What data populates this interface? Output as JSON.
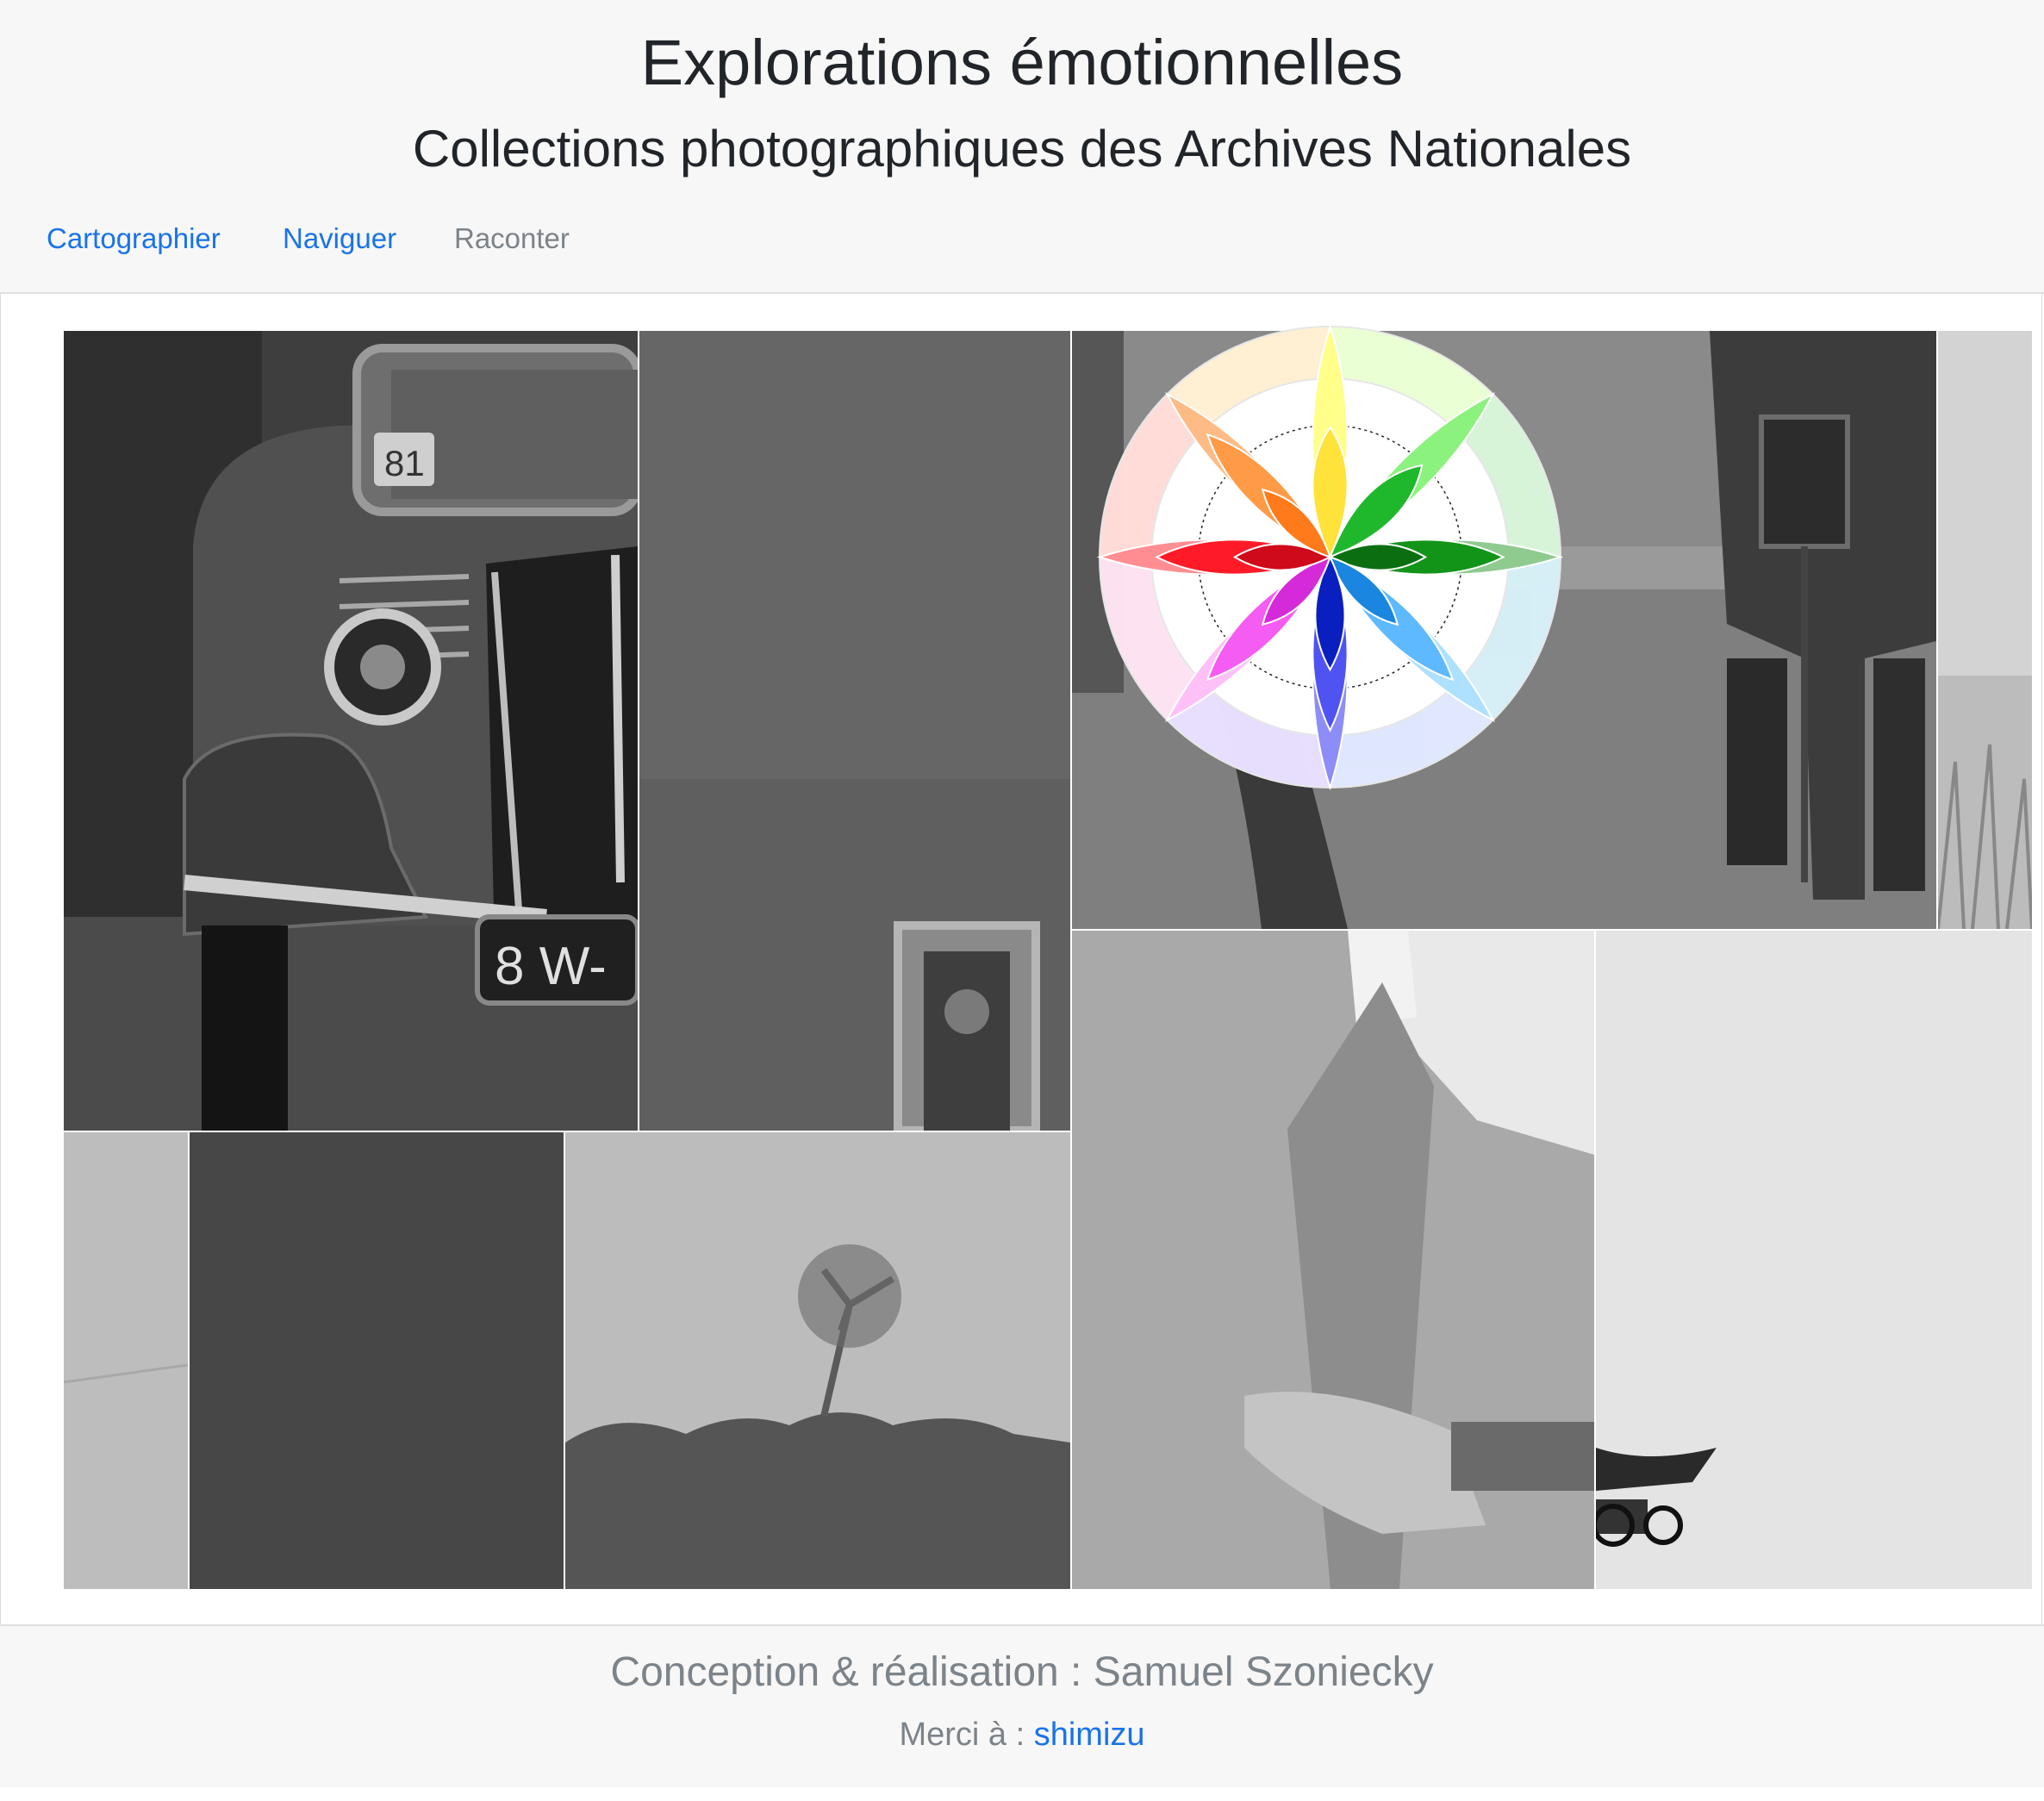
{
  "header": {
    "title": "Explorations émotionnelles",
    "subtitle": "Collections photographiques des Archives Nationales"
  },
  "nav": {
    "items": [
      {
        "label": "Cartographier",
        "active": true,
        "color": "#1a73e8"
      },
      {
        "label": "Naviguer",
        "active": true,
        "color": "#1a73e8"
      },
      {
        "label": "Raconter",
        "active": false,
        "color": "#7c8389"
      }
    ]
  },
  "mosaic": {
    "tiles": [
      {
        "subject": "vintage car front with headlight",
        "plate_top": "81",
        "plate_bottom": "8 W-"
      },
      {
        "subject": "grey wall with framed portrait"
      },
      {
        "subject": "legs of two men in a field"
      },
      {
        "subject": "man in tweed jacket"
      },
      {
        "subject": "light grey sky with hat brim and glasses"
      },
      {
        "subject": "plain light grey"
      },
      {
        "subject": "plain dark grey"
      },
      {
        "subject": "tree line under overcast sky"
      },
      {
        "subject": "grass field edge"
      }
    ]
  },
  "emotion_wheel": {
    "icon": "plutchik-emotion-wheel",
    "petal_colors": [
      "#ffe85c",
      "#1fb82c",
      "#148a1e",
      "#2e8ae0",
      "#0a1fbf",
      "#d42ad9",
      "#cf0a1a",
      "#ff7a1a"
    ]
  },
  "footer": {
    "credits": "Conception & réalisation : Samuel Szoniecky",
    "thanks_prefix": "Merci à :",
    "thanks_link": "shimizu"
  }
}
